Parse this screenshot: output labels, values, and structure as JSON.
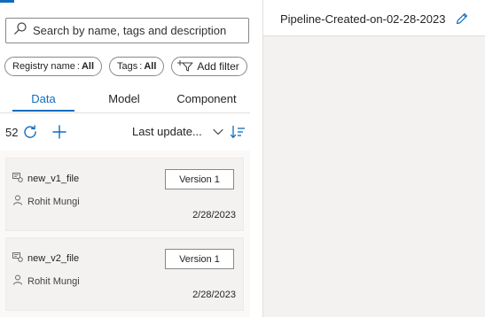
{
  "search": {
    "placeholder": "Search by name, tags and description"
  },
  "filters": {
    "registry": {
      "label": "Registry name",
      "value": "All"
    },
    "tags": {
      "label": "Tags",
      "value": "All"
    },
    "add_filter_label": "Add filter"
  },
  "tabs": [
    {
      "label": "Data",
      "active": true
    },
    {
      "label": "Model",
      "active": false
    },
    {
      "label": "Component",
      "active": false
    }
  ],
  "toolbar": {
    "count": "52",
    "sort_label": "Last update..."
  },
  "cards": [
    {
      "title": "new_v1_file",
      "author": "Rohit Mungi",
      "version": "Version 1",
      "date": "2/28/2023"
    },
    {
      "title": "new_v2_file",
      "author": "Rohit Mungi",
      "version": "Version 1",
      "date": "2/28/2023"
    }
  ],
  "pipeline": {
    "title": "Pipeline-Created-on-02-28-2023"
  },
  "colors": {
    "accent": "#0f6cbd",
    "canvas": "#f3f2f1"
  },
  "icons": [
    "search-icon",
    "filter-icon",
    "refresh-icon",
    "plus-icon",
    "chevron-down-icon",
    "sort-icon",
    "dataset-icon",
    "person-icon",
    "pencil-icon"
  ]
}
